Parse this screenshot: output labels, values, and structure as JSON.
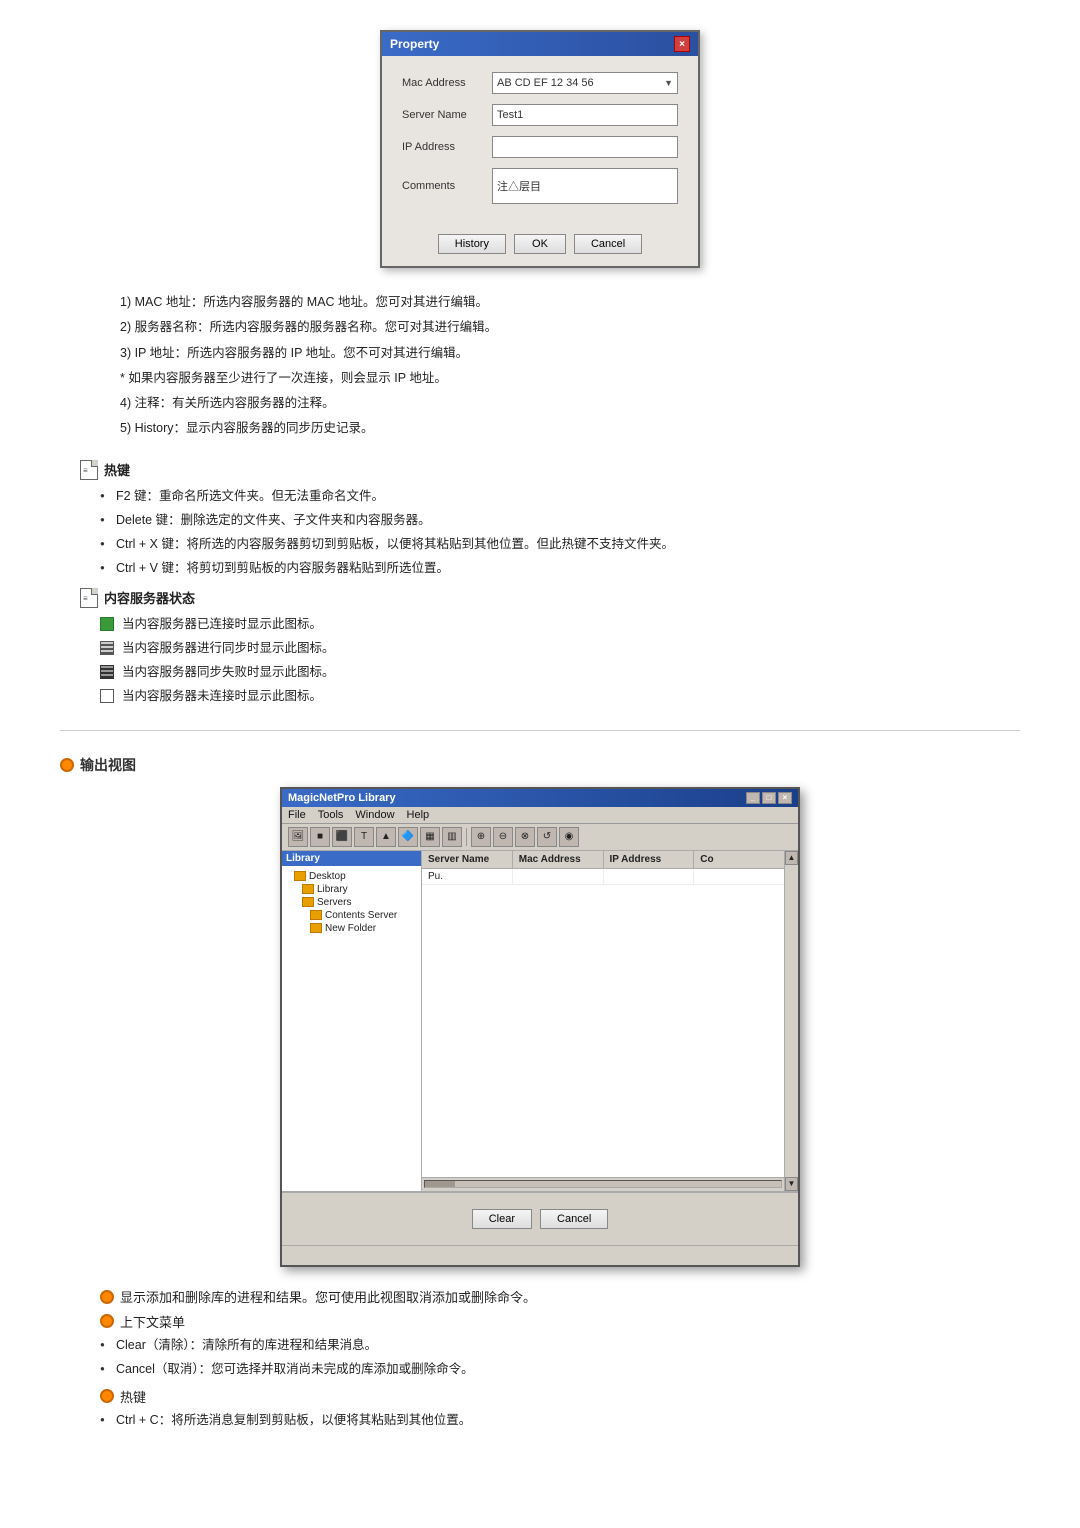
{
  "property_dialog": {
    "title": "Property",
    "close_btn": "×",
    "fields": [
      {
        "label": "Mac Address",
        "value": "AB CD EF 12 34 56",
        "type": "dropdown"
      },
      {
        "label": "Server Name",
        "value": "Test1",
        "type": "text"
      },
      {
        "label": "IP Address",
        "value": "",
        "type": "text"
      },
      {
        "label": "Comments",
        "value": "注△层目",
        "type": "textarea"
      }
    ],
    "buttons": [
      "History",
      "OK",
      "Cancel"
    ]
  },
  "section1": {
    "items": [
      "1) MAC 地址：所选内容服务器的 MAC 地址。您可对其进行编辑。",
      "2) 服务器名称：所选内容服务器的服务器名称。您可对其进行编辑。",
      "3) IP 地址：所选内容服务器的 IP 地址。您不可对其进行编辑。",
      "* 如果内容服务器至少进行了一次连接，则会显示 IP 地址。",
      "4) 注释：有关所选内容服务器的注释。",
      "5) History：显示内容服务器的同步历史记录。"
    ]
  },
  "hotkey_section1": {
    "title": "热键",
    "bullets": [
      "F2 键：重命名所选文件夹。但无法重命名文件。",
      "Delete 键：删除选定的文件夹、子文件夹和内容服务器。",
      "Ctrl + X 键：将所选的内容服务器剪切到剪贴板，以便将其粘贴到其他位置。但此热键不支持文件夹。",
      "Ctrl + V 键：将剪切到剪贴板的内容服务器粘贴到所选位置。"
    ]
  },
  "status_section": {
    "title": "内容服务器状态",
    "items": [
      "当内容服务器已连接时显示此图标。",
      "当内容服务器进行同步时显示此图标。",
      "当内容服务器同步失败时显示此图标。",
      "当内容服务器未连接时显示此图标。"
    ]
  },
  "output_section": {
    "title": "输出视图",
    "app_title": "MagicNetPro Library",
    "menu_items": [
      "File",
      "Tools",
      "Window",
      "Help"
    ],
    "table_headers": [
      "Server Name",
      "Mac Address",
      "IP Address",
      "Co"
    ],
    "table_rows": [
      [
        "Pu.",
        "",
        "",
        ""
      ]
    ],
    "sidebar": {
      "header": "Library",
      "items": [
        "Desktop",
        "Library",
        "Servers",
        "Contents Server",
        "New Folder"
      ]
    },
    "titlebar_btns": [
      "_",
      "□",
      "×"
    ],
    "bottom_buttons": [
      "Clear",
      "Cancel"
    ]
  },
  "output_notes": {
    "main": "显示添加和删除库的进程和结果。您可使用此视图取消添加或删除命令。",
    "submenu_title": "上下文菜单",
    "submenu_items": [
      "Clear（清除）：清除所有的库进程和结果消息。",
      "Cancel（取消）：您可选择并取消尚未完成的库添加或删除命令。"
    ]
  },
  "hotkey_section2": {
    "title": "热键",
    "bullets": [
      "Ctrl + C：将所选消息复制到剪贴板，以便将其粘贴到其他位置。"
    ]
  }
}
